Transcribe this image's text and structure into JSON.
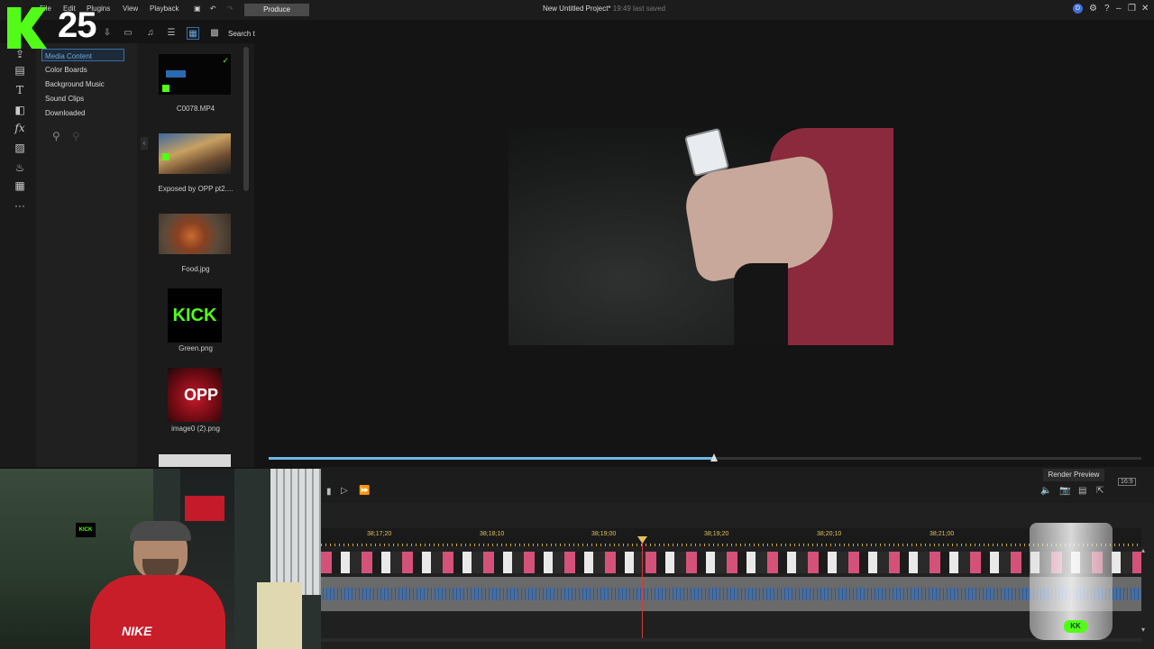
{
  "menubar": {
    "items": [
      "File",
      "Edit",
      "Plugins",
      "View",
      "Playback"
    ],
    "produce": "Produce",
    "project_title": "New Untitled Project*",
    "project_status": "19:49 last saved"
  },
  "overlay": {
    "logo_text": "K",
    "number": "25"
  },
  "library": {
    "search_label": "Search t",
    "tree": [
      "Media Content",
      "Color Boards",
      "Background Music",
      "Sound Clips",
      "Downloaded"
    ],
    "thumbnails": [
      {
        "label": "C0078.MP4"
      },
      {
        "label": "Exposed by OPP pt2...."
      },
      {
        "label": "Food.jpg"
      },
      {
        "label": "Green.png",
        "badge_text": "KICK"
      },
      {
        "label": "image0 (2).png",
        "badge_text": "OPP"
      }
    ]
  },
  "player": {
    "render_preview": "Render Preview",
    "progress": 0.51,
    "aspect_label": "16:9"
  },
  "timeline": {
    "ticks": [
      "38;17;20",
      "38;18;10",
      "38;19;00",
      "38;19;20",
      "38;20;10",
      "38;21;00"
    ]
  },
  "webcam": {
    "shirt_text": "NIKE"
  },
  "colors": {
    "kick_green": "#53fc18",
    "accent_blue": "#6bb9e6",
    "playhead": "#d23c3c"
  }
}
